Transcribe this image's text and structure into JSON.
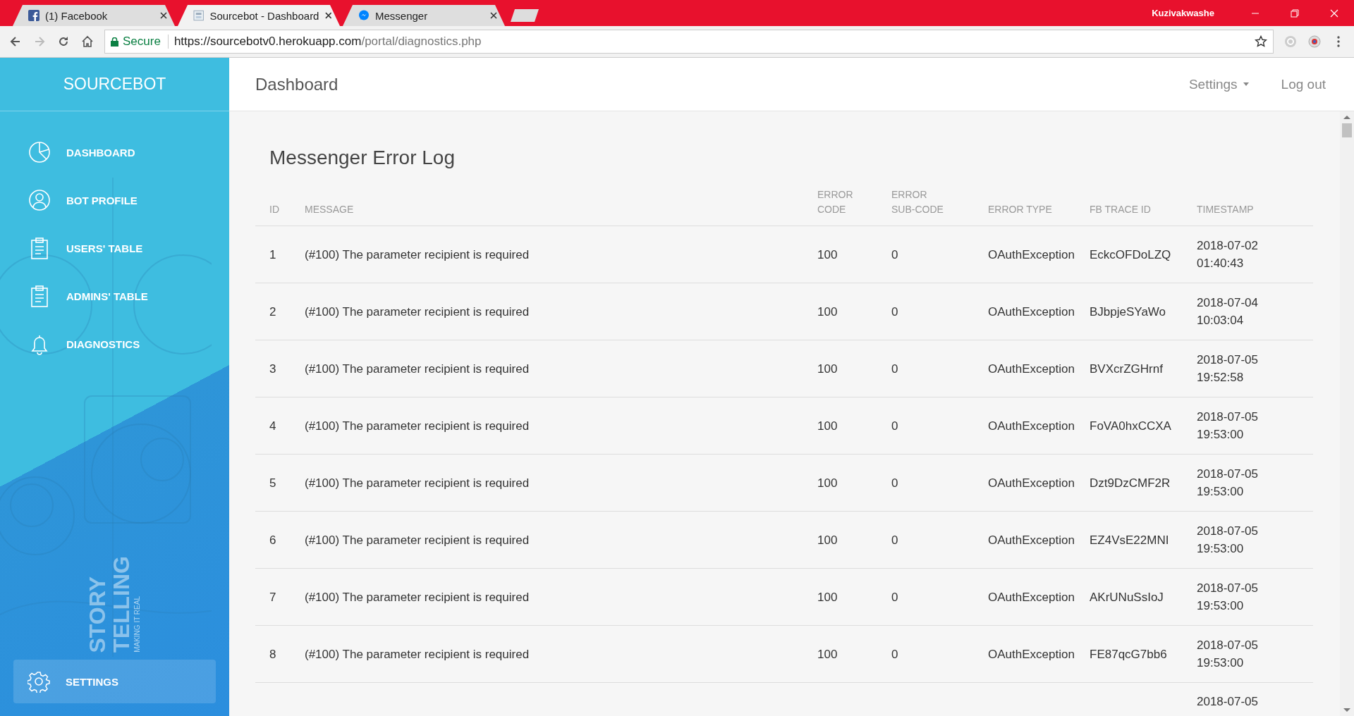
{
  "browser": {
    "tabs": [
      {
        "title": "(1) Facebook",
        "selected": false
      },
      {
        "title": "Sourcebot - Dashboard",
        "selected": true
      },
      {
        "title": "Messenger",
        "selected": false
      }
    ],
    "user": "Kuzivakwashe",
    "address": {
      "secure_label": "Secure",
      "origin": "https://sourcebotv0.herokuapp.com",
      "path": "/portal/diagnostics.php"
    }
  },
  "sidebar": {
    "brand": "SOURCEBOT",
    "items": [
      {
        "label": "DASHBOARD"
      },
      {
        "label": "BOT PROFILE"
      },
      {
        "label": "USERS' TABLE"
      },
      {
        "label": "ADMINS' TABLE"
      },
      {
        "label": "DIAGNOSTICS"
      }
    ],
    "art_texts": [
      "STORY",
      "TELLING",
      "MAKING IT REAL"
    ],
    "settings": {
      "label": "SETTINGS"
    }
  },
  "header": {
    "title": "Dashboard",
    "settings": "Settings",
    "logout": "Log out"
  },
  "log": {
    "title": "Messenger Error Log",
    "columns": [
      "ID",
      "MESSAGE",
      "ERROR CODE",
      "ERROR SUB-CODE",
      "ERROR TYPE",
      "FB TRACE ID",
      "TIMESTAMP"
    ],
    "rows": [
      [
        "1",
        "(#100) The parameter recipient is required",
        "100",
        "0",
        "OAuthException",
        "EckcOFDoLZQ",
        "2018-07-02 01:40:43"
      ],
      [
        "2",
        "(#100) The parameter recipient is required",
        "100",
        "0",
        "OAuthException",
        "BJbpjeSYaWo",
        "2018-07-04 10:03:04"
      ],
      [
        "3",
        "(#100) The parameter recipient is required",
        "100",
        "0",
        "OAuthException",
        "BVXcrZGHrnf",
        "2018-07-05 19:52:58"
      ],
      [
        "4",
        "(#100) The parameter recipient is required",
        "100",
        "0",
        "OAuthException",
        "FoVA0hxCCXA",
        "2018-07-05 19:53:00"
      ],
      [
        "5",
        "(#100) The parameter recipient is required",
        "100",
        "0",
        "OAuthException",
        "Dzt9DzCMF2R",
        "2018-07-05 19:53:00"
      ],
      [
        "6",
        "(#100) The parameter recipient is required",
        "100",
        "0",
        "OAuthException",
        "EZ4VsE22MNI",
        "2018-07-05 19:53:00"
      ],
      [
        "7",
        "(#100) The parameter recipient is required",
        "100",
        "0",
        "OAuthException",
        "AKrUNuSsIoJ",
        "2018-07-05 19:53:00"
      ],
      [
        "8",
        "(#100) The parameter recipient is required",
        "100",
        "0",
        "OAuthException",
        "FE87qcG7bb6",
        "2018-07-05 19:53:00"
      ],
      [
        null,
        null,
        null,
        null,
        null,
        null,
        "2018-07-05"
      ]
    ]
  }
}
